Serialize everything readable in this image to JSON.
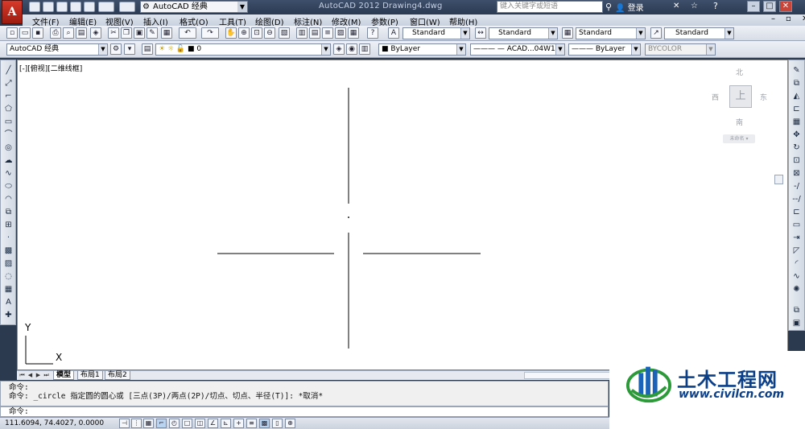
{
  "app": {
    "title": "AutoCAD 2012    Drawing4.dwg",
    "logo_letter": "A",
    "workspace": "AutoCAD 经典",
    "search_placeholder": "键入关键字或短语",
    "login": "登录"
  },
  "menu": [
    "文件(F)",
    "编辑(E)",
    "视图(V)",
    "插入(I)",
    "格式(O)",
    "工具(T)",
    "绘图(D)",
    "标注(N)",
    "修改(M)",
    "参数(P)",
    "窗口(W)",
    "帮助(H)"
  ],
  "styles_toolbar": {
    "text_style": "Standard",
    "dim_style": "Standard",
    "table_style": "Standard",
    "mleader_style": "Standard"
  },
  "properties_toolbar": {
    "workspace": "AutoCAD 经典",
    "layer": "0",
    "color": "ByLayer",
    "linetype": "ACAD...04W100",
    "lineweight": "ByLayer",
    "plotstyle": "BYCOLOR"
  },
  "viewport": {
    "label": "[-][俯视][二维线框]"
  },
  "viewcube": {
    "north": "北",
    "south": "南",
    "east": "东",
    "west": "西",
    "face": "上",
    "wcs": "未命名 ▾"
  },
  "ucs": {
    "x": "X",
    "y": "Y"
  },
  "tabs": [
    "模型",
    "布局1",
    "布局2"
  ],
  "command": {
    "history": [
      "命令:",
      "命令: _circle 指定圆的圆心或 [三点(3P)/两点(2P)/切点、切点、半径(T)]: *取消*"
    ],
    "prompt": "命令:"
  },
  "status": {
    "coords": "111.6094, 74.4027, 0.0000"
  },
  "watermark": {
    "title": "土木工程网",
    "url": "www.civilcn.com"
  },
  "colors": {
    "title_bg": "#2c3a52",
    "canvas": "#ffffff",
    "watermark_blue": "#0b3f88"
  }
}
